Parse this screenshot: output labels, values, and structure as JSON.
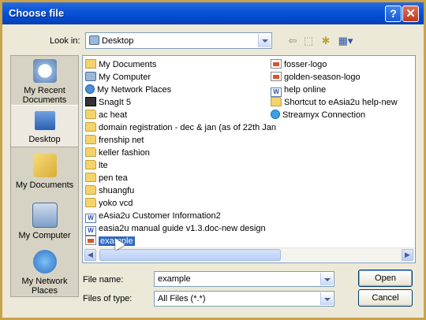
{
  "window": {
    "title": "Choose file",
    "help_glyph": "?",
    "close_glyph": "✕"
  },
  "lookin": {
    "label": "Look in:",
    "value": "Desktop"
  },
  "toolbar": {
    "back_glyph": "⇦",
    "up_glyph": "⬚",
    "newfolder_glyph": "✱",
    "views_glyph": "▦▾"
  },
  "places": [
    {
      "label": "My Recent Documents",
      "icon": "recent-docs-icon"
    },
    {
      "label": "Desktop",
      "icon": "desktop-icon"
    },
    {
      "label": "My Documents",
      "icon": "my-documents-icon"
    },
    {
      "label": "My Computer",
      "icon": "my-computer-icon"
    },
    {
      "label": "My Network Places",
      "icon": "network-places-icon"
    }
  ],
  "files_col1": [
    {
      "name": "My Documents",
      "type": "mydocs"
    },
    {
      "name": "My Computer",
      "type": "computer"
    },
    {
      "name": "My Network Places",
      "type": "net"
    },
    {
      "name": "SnagIt 5",
      "type": "snag"
    },
    {
      "name": "ac heat",
      "type": "folder"
    },
    {
      "name": "domain registration - dec & jan (as of 22th Jan",
      "type": "folder"
    },
    {
      "name": "frenship net",
      "type": "folder"
    },
    {
      "name": "keller fashion",
      "type": "folder"
    },
    {
      "name": "lte",
      "type": "folder"
    },
    {
      "name": "pen tea",
      "type": "folder"
    },
    {
      "name": "shuangfu",
      "type": "folder"
    },
    {
      "name": "yoko vcd",
      "type": "folder"
    },
    {
      "name": "eAsia2u Customer Information2",
      "type": "doc"
    },
    {
      "name": "easia2u manual guide v1.3.doc-new design",
      "type": "doc"
    },
    {
      "name": "example",
      "type": "img",
      "selected": true
    }
  ],
  "files_col2": [
    {
      "name": "fosser-logo",
      "type": "img"
    },
    {
      "name": "golden-season-logo",
      "type": "img"
    },
    {
      "name": "help online",
      "type": "doc"
    },
    {
      "name": "Shortcut to eAsia2u help-new",
      "type": "folder"
    },
    {
      "name": "Streamyx Connection",
      "type": "shortcut"
    }
  ],
  "filename": {
    "label": "File name:",
    "value": "example"
  },
  "filetype": {
    "label": "Files of type:",
    "value": "All Files (*.*)"
  },
  "buttons": {
    "open": "Open",
    "cancel": "Cancel"
  },
  "scroll": {
    "left_glyph": "◀",
    "right_glyph": "▶"
  }
}
